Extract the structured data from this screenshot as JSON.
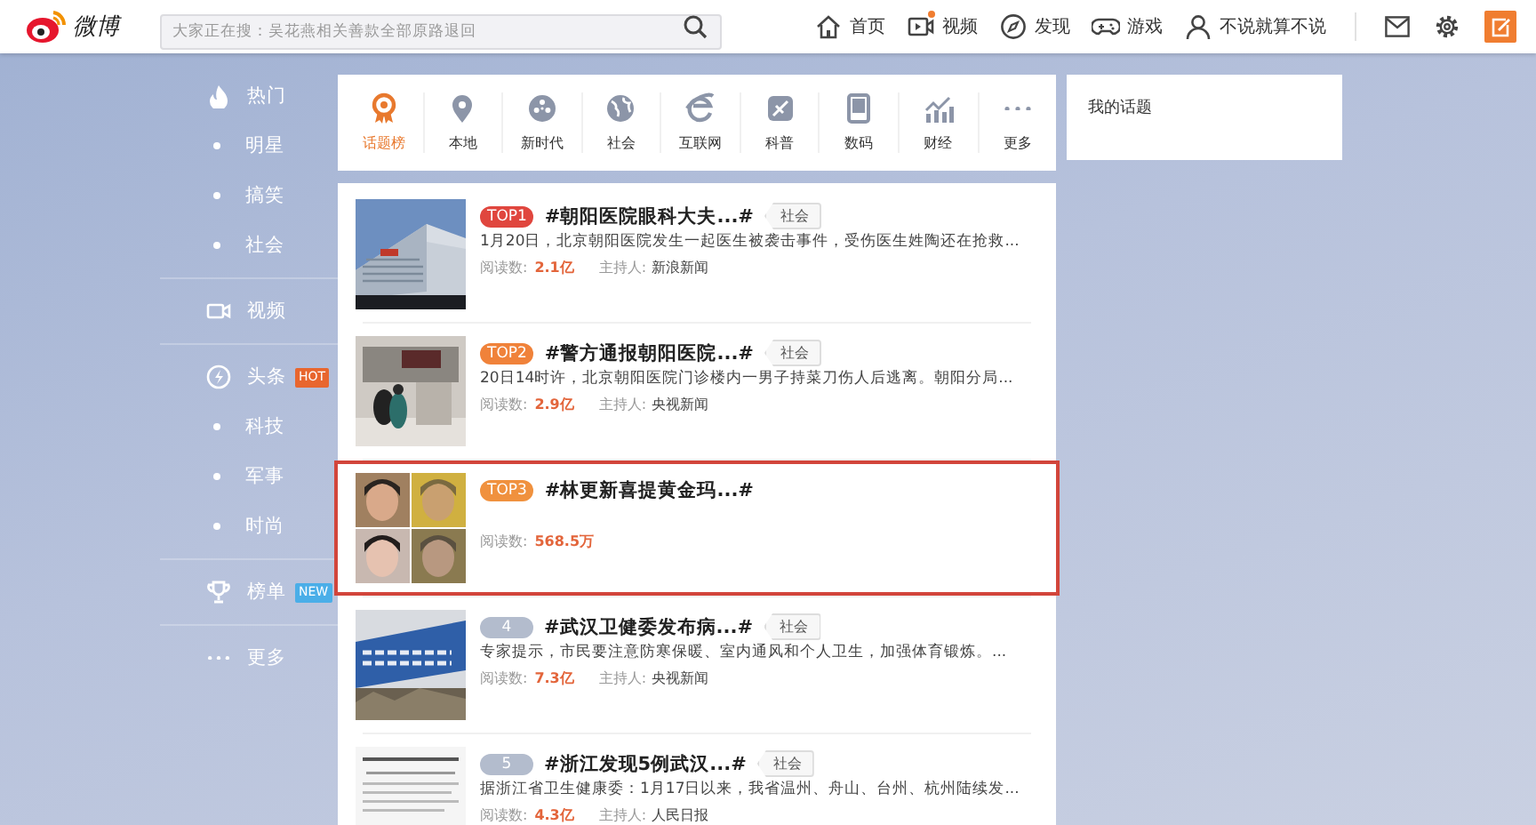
{
  "topbar": {
    "logo": "微博",
    "search": {
      "placeholder": "大家正在搜：吴花燕相关善款全部原路退回"
    },
    "nav": [
      {
        "label": "首页",
        "has_dot": false
      },
      {
        "label": "视频",
        "has_dot": true
      },
      {
        "label": "发现",
        "has_dot": false
      },
      {
        "label": "游戏",
        "has_dot": false
      },
      {
        "label": "不说就算不说",
        "has_dot": false
      }
    ]
  },
  "sidebar": {
    "items": [
      {
        "kind": "section",
        "label": "热门"
      },
      {
        "kind": "sub",
        "label": "明星"
      },
      {
        "kind": "sub",
        "label": "搞笑"
      },
      {
        "kind": "sub",
        "label": "社会"
      },
      {
        "kind": "section",
        "label": "视频"
      },
      {
        "kind": "section",
        "label": "头条",
        "badge": "HOT",
        "color": "#e8662e"
      },
      {
        "kind": "sub",
        "label": "科技"
      },
      {
        "kind": "sub",
        "label": "军事"
      },
      {
        "kind": "sub",
        "label": "时尚"
      },
      {
        "kind": "section",
        "label": "榜单",
        "badge": "NEW",
        "color": "#4aaee8"
      },
      {
        "kind": "section",
        "label": "更多"
      }
    ]
  },
  "categories": [
    {
      "label": "话题榜",
      "selected": true
    },
    {
      "label": "本地",
      "selected": false
    },
    {
      "label": "新时代",
      "selected": false
    },
    {
      "label": "社会",
      "selected": false
    },
    {
      "label": "互联网",
      "selected": false
    },
    {
      "label": "科普",
      "selected": false
    },
    {
      "label": "数码",
      "selected": false
    },
    {
      "label": "财经",
      "selected": false
    },
    {
      "label": "更多",
      "selected": false
    }
  ],
  "topics": [
    {
      "rank": "TOP1",
      "color": "#e0463e",
      "title": "#朝阳医院眼科大夫...#",
      "tag": "社会",
      "summary": "1月20日，北京朝阳医院发生一起医生被袭击事件，受伤医生姓陶还在抢救...",
      "reads_label": "阅读数:",
      "reads": "2.1亿",
      "host_label": "主持人:",
      "host": "新浪新闻",
      "highlighted": false
    },
    {
      "rank": "TOP2",
      "color": "#f0823a",
      "title": "#警方通报朝阳医院...#",
      "tag": "社会",
      "summary": "20日14时许，北京朝阳医院门诊楼内一男子持菜刀伤人后逃离。朝阳分局...",
      "reads_label": "阅读数:",
      "reads": "2.9亿",
      "host_label": "主持人:",
      "host": "央视新闻",
      "highlighted": false
    },
    {
      "rank": "TOP3",
      "color": "#f0913e",
      "title": "#林更新喜提黄金玛...#",
      "reads_label": "阅读数:",
      "reads": "568.5万",
      "highlighted": true
    },
    {
      "rank": "4",
      "color": "#b3bccd",
      "title": "#武汉卫健委发布病...#",
      "tag": "社会",
      "summary": "专家提示，市民要注意防寒保暖、室内通风和个人卫生，加强体育锻炼。...",
      "reads_label": "阅读数:",
      "reads": "7.3亿",
      "host_label": "主持人:",
      "host": "央视新闻",
      "highlighted": false
    },
    {
      "rank": "5",
      "color": "#b3bccd",
      "title": "#浙江发现5例武汉...#",
      "tag": "社会",
      "summary": "据浙江省卫生健康委：1月17日以来，我省温州、舟山、台州、杭州陆续发...",
      "reads_label": "阅读数:",
      "reads": "4.3亿",
      "host_label": "主持人:",
      "host": "人民日报",
      "highlighted": false
    }
  ],
  "my_topics": {
    "title": "我的话题"
  }
}
